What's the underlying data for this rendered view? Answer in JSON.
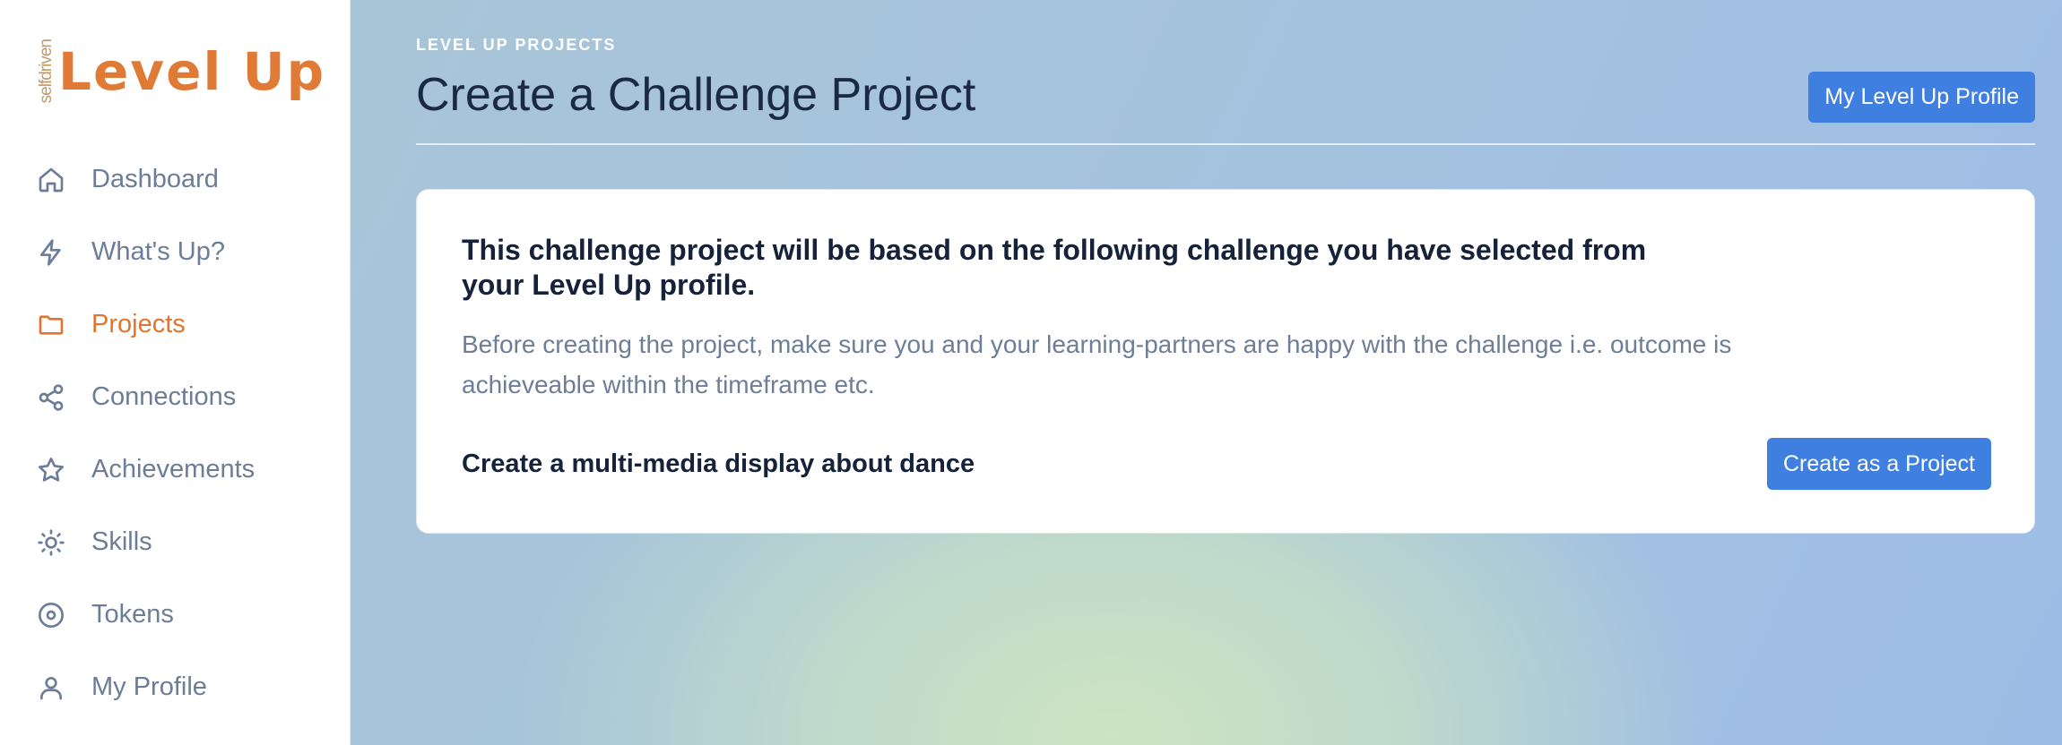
{
  "logo": {
    "small_text": "selfdriven",
    "main_text": "Level Up"
  },
  "sidebar": {
    "items": [
      {
        "label": "Dashboard",
        "icon": "home-icon",
        "active": false
      },
      {
        "label": "What's Up?",
        "icon": "lightning-icon",
        "active": false
      },
      {
        "label": "Projects",
        "icon": "folder-icon",
        "active": true
      },
      {
        "label": "Connections",
        "icon": "share-icon",
        "active": false
      },
      {
        "label": "Achievements",
        "icon": "star-icon",
        "active": false
      },
      {
        "label": "Skills",
        "icon": "sun-icon",
        "active": false
      },
      {
        "label": "Tokens",
        "icon": "disc-icon",
        "active": false
      },
      {
        "label": "My Profile",
        "icon": "user-icon",
        "active": false
      }
    ]
  },
  "header": {
    "eyebrow": "LEVEL UP PROJECTS",
    "title": "Create a Challenge Project",
    "profile_button": "My Level Up Profile"
  },
  "card": {
    "title": "This challenge project will be based on the following challenge you have selected from your Level Up profile.",
    "text": "Before creating the project, make sure you and your learning-partners are happy with the challenge i.e. outcome is achieveable within the timeframe etc.",
    "challenge": "Create a multi-media display about dance",
    "create_button": "Create as a Project"
  },
  "colors": {
    "accent": "#3f7fe0",
    "active_nav": "#e2742f",
    "nav_text": "#6b7d97",
    "heading": "#1b2a44"
  }
}
